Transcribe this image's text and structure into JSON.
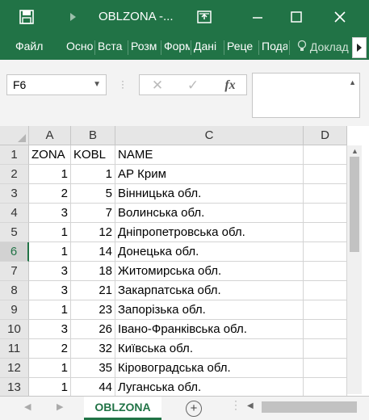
{
  "window": {
    "title": "OBLZONA -...",
    "icons": [
      "save-icon",
      "redo-icon",
      "restore-window-icon",
      "minimize-icon",
      "maximize-icon",
      "close-icon"
    ]
  },
  "ribbon": {
    "tabs": [
      "Файл",
      "Осно",
      "Вста",
      "Розм",
      "Форм",
      "Дані",
      "Реце",
      "Подан"
    ],
    "help": "Доклад"
  },
  "formula_bar": {
    "name_box": "F6",
    "cancel_symbol": "✕",
    "enter_symbol": "✓",
    "fx_label": "fx",
    "formula_value": ""
  },
  "sheet": {
    "columns": [
      "A",
      "B",
      "C",
      "D"
    ],
    "rows": [
      {
        "num": "1",
        "a": "ZONA",
        "b": "KOBL",
        "c": "NAME"
      },
      {
        "num": "2",
        "a": "1",
        "b": "1",
        "c": "АР Крим"
      },
      {
        "num": "3",
        "a": "2",
        "b": "5",
        "c": "Вінницька обл."
      },
      {
        "num": "4",
        "a": "3",
        "b": "7",
        "c": "Волинська обл."
      },
      {
        "num": "5",
        "a": "1",
        "b": "12",
        "c": "Дніпропетровська обл."
      },
      {
        "num": "6",
        "a": "1",
        "b": "14",
        "c": "Донецька обл."
      },
      {
        "num": "7",
        "a": "3",
        "b": "18",
        "c": "Житомирська обл."
      },
      {
        "num": "8",
        "a": "3",
        "b": "21",
        "c": "Закарпатська обл."
      },
      {
        "num": "9",
        "a": "1",
        "b": "23",
        "c": "Запорізька обл."
      },
      {
        "num": "10",
        "a": "3",
        "b": "26",
        "c": "Івано-Франківська обл."
      },
      {
        "num": "11",
        "a": "2",
        "b": "32",
        "c": "Київська обл."
      },
      {
        "num": "12",
        "a": "1",
        "b": "35",
        "c": "Кіровоградська обл."
      },
      {
        "num": "13",
        "a": "1",
        "b": "44",
        "c": "Луганська обл."
      }
    ],
    "selected_row": "6"
  },
  "sheet_tabs": {
    "active": "OBLZONA",
    "add_symbol": "+"
  },
  "colors": {
    "accent": "#217346"
  }
}
